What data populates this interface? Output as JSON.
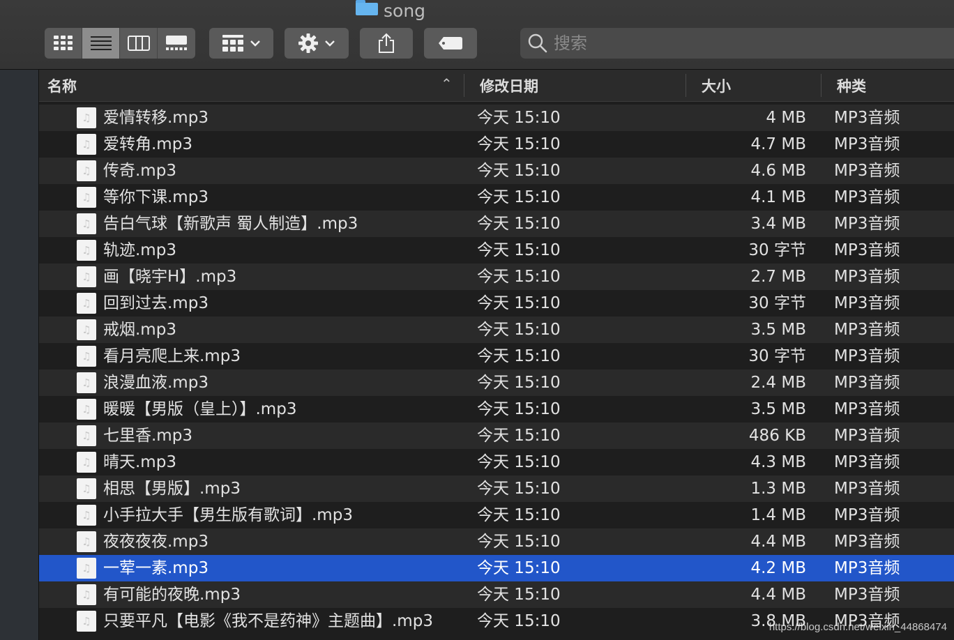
{
  "window": {
    "title": "song",
    "search_placeholder": "搜索"
  },
  "toolbar": {
    "view_buttons": [
      {
        "icon": "icon-view-grid-icon",
        "active": false
      },
      {
        "icon": "list-view-icon",
        "active": true
      },
      {
        "icon": "column-view-icon",
        "active": false
      },
      {
        "icon": "gallery-view-icon",
        "active": false
      }
    ],
    "group_button_icon": "group-grid-icon",
    "action_button_icon": "gear-icon",
    "share_button_icon": "share-icon",
    "tag_button_icon": "tag-icon"
  },
  "columns": {
    "name": "名称",
    "date": "修改日期",
    "size": "大小",
    "kind": "种类",
    "sort_indicator": "⌃"
  },
  "files": [
    {
      "name": "爱情转移.mp3",
      "date": "今天 15:10",
      "size": "4 MB",
      "kind": "MP3音频"
    },
    {
      "name": "爱转角.mp3",
      "date": "今天 15:10",
      "size": "4.7 MB",
      "kind": "MP3音频"
    },
    {
      "name": "传奇.mp3",
      "date": "今天 15:10",
      "size": "4.6 MB",
      "kind": "MP3音频"
    },
    {
      "name": "等你下课.mp3",
      "date": "今天 15:10",
      "size": "4.1 MB",
      "kind": "MP3音频"
    },
    {
      "name": "告白气球【新歌声 蜀人制造】.mp3",
      "date": "今天 15:10",
      "size": "3.4 MB",
      "kind": "MP3音频"
    },
    {
      "name": "轨迹.mp3",
      "date": "今天 15:10",
      "size": "30 字节",
      "kind": "MP3音频"
    },
    {
      "name": "画【晓宇H】.mp3",
      "date": "今天 15:10",
      "size": "2.7 MB",
      "kind": "MP3音频"
    },
    {
      "name": "回到过去.mp3",
      "date": "今天 15:10",
      "size": "30 字节",
      "kind": "MP3音频"
    },
    {
      "name": "戒烟.mp3",
      "date": "今天 15:10",
      "size": "3.5 MB",
      "kind": "MP3音频"
    },
    {
      "name": "看月亮爬上来.mp3",
      "date": "今天 15:10",
      "size": "30 字节",
      "kind": "MP3音频"
    },
    {
      "name": "浪漫血液.mp3",
      "date": "今天 15:10",
      "size": "2.4 MB",
      "kind": "MP3音频"
    },
    {
      "name": "暖暖【男版（皇上）】.mp3",
      "date": "今天 15:10",
      "size": "3.5 MB",
      "kind": "MP3音频"
    },
    {
      "name": "七里香.mp3",
      "date": "今天 15:10",
      "size": "486 KB",
      "kind": "MP3音频"
    },
    {
      "name": "晴天.mp3",
      "date": "今天 15:10",
      "size": "4.3 MB",
      "kind": "MP3音频"
    },
    {
      "name": "相思【男版】.mp3",
      "date": "今天 15:10",
      "size": "1.3 MB",
      "kind": "MP3音频"
    },
    {
      "name": "小手拉大手【男生版有歌词】.mp3",
      "date": "今天 15:10",
      "size": "1.4 MB",
      "kind": "MP3音频"
    },
    {
      "name": "夜夜夜夜.mp3",
      "date": "今天 15:10",
      "size": "4.4 MB",
      "kind": "MP3音频"
    },
    {
      "name": "一荤一素.mp3",
      "date": "今天 15:10",
      "size": "4.2 MB",
      "kind": "MP3音频",
      "selected": true
    },
    {
      "name": "有可能的夜晚.mp3",
      "date": "今天 15:10",
      "size": "4.4 MB",
      "kind": "MP3音频"
    },
    {
      "name": "只要平凡【电影《我不是药神》主题曲】.mp3",
      "date": "今天 15:10",
      "size": "3.8 MB",
      "kind": "MP3音频"
    }
  ],
  "watermark": "https://blog.csdn.net/weixin_44868474",
  "colors": {
    "selection": "#2256c9",
    "folder": "#66b5ef"
  }
}
